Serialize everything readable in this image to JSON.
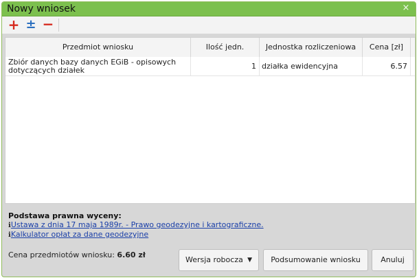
{
  "window": {
    "title": "Nowy wniosek",
    "close_icon": "×"
  },
  "toolbar": {
    "add_icon": "+",
    "edit_icon": "±",
    "remove_icon": "−"
  },
  "grid": {
    "columns": [
      "Przedmiot wniosku",
      "Ilość jedn.",
      "Jednostka rozliczeniowa",
      "Cena [zł]"
    ],
    "rows": [
      {
        "name": "Zbiór danych bazy danych EGiB - opisowych dotyczących działek",
        "qty": "1",
        "unit": "działka ewidencyjna",
        "price": "6.57"
      }
    ]
  },
  "legal": {
    "title": "Podstawa prawna wyceny:",
    "info_icon": "ℹ",
    "links": [
      "Ustawa z dnia 17 maja 1989r. - Prawo geodezyjne i kartograficzne.",
      "Kalkulator opłat za dane geodezyjne"
    ]
  },
  "footer": {
    "total_label": "Cena przedmiotów wniosku:",
    "total_value": "6.60 zł",
    "draft_label": "Wersja robocza",
    "draft_caret": "▼",
    "summary_label": "Podsumowanie wniosku",
    "cancel_label": "Anuluj"
  },
  "colors": {
    "titlebar": "#7cc04e",
    "add": "#d6281d",
    "edit": "#2b6fbf",
    "link": "#1a3fa8"
  }
}
